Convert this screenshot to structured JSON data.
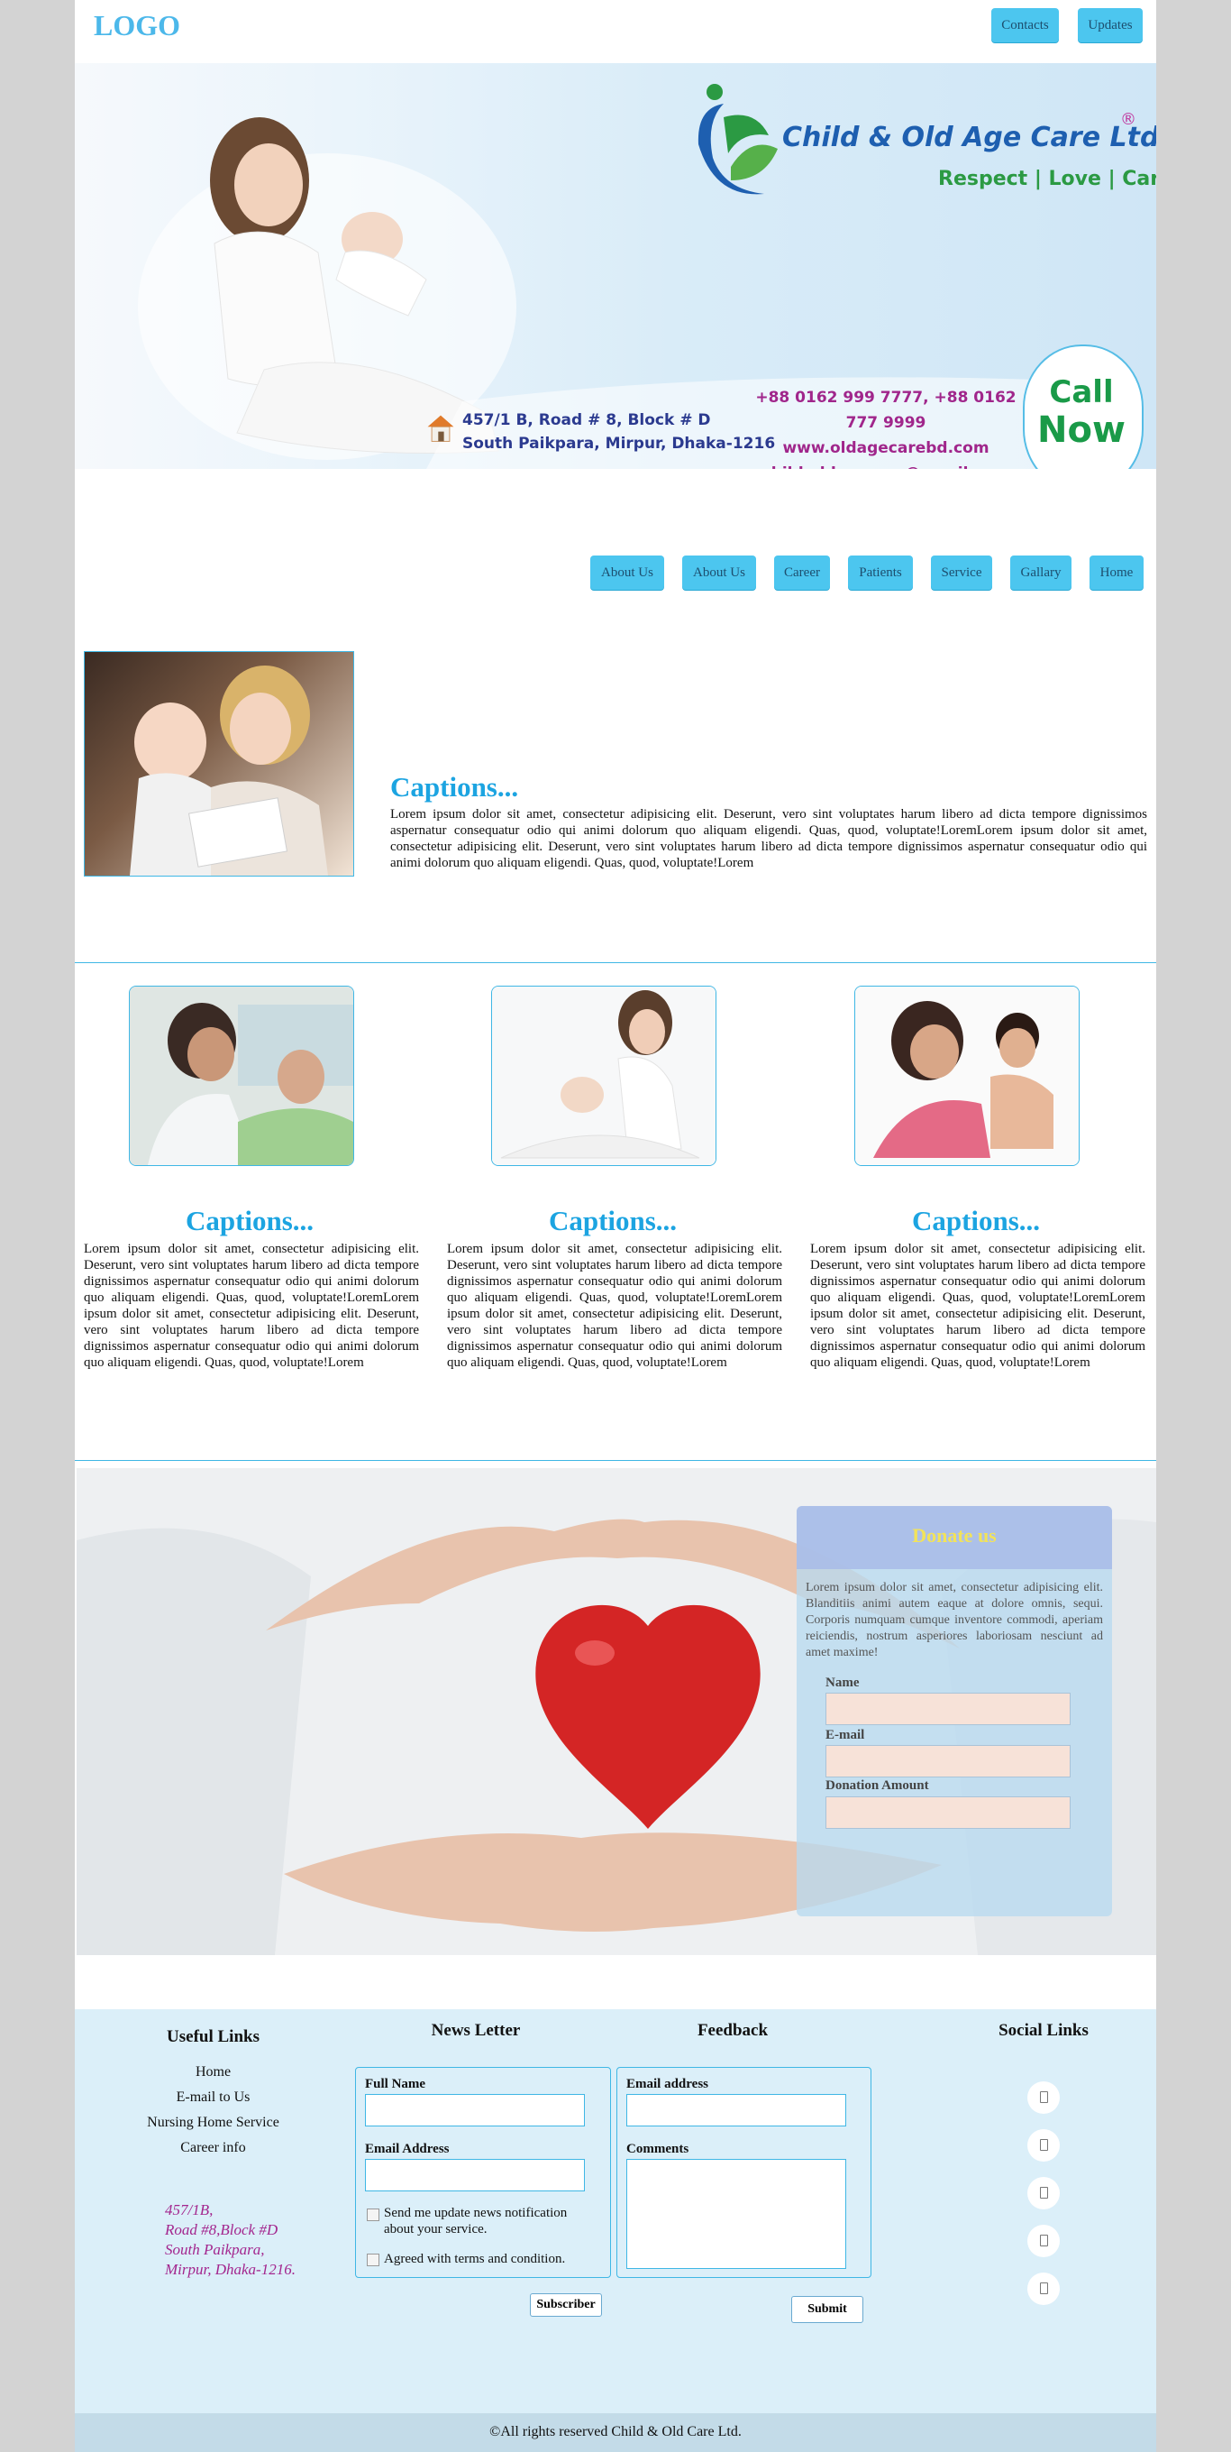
{
  "header": {
    "logo": "LOGO",
    "buttons": [
      "Contacts",
      "Updates"
    ]
  },
  "banner": {
    "brand_name": "Child & Old Age Care Ltd.",
    "brand_reg": "®",
    "tagline": "Respect | Love | Care",
    "address_line1": "457/1 B, Road # 8, Block # D",
    "address_line2": "South Paikpara, Mirpur, Dhaka-1216",
    "phones": "+88 0162 999 7777, +88 0162 777 9999",
    "website": "www.oldagecarebd.com",
    "email": "child.oldagecare@gmail.com",
    "call_line1": "Call",
    "call_line2": "Now"
  },
  "nav": [
    "About Us",
    "About Us",
    "Career",
    "Patients",
    "Service",
    "Gallary",
    "Home"
  ],
  "feature": {
    "caption": "Captions...",
    "text": "Lorem ipsum dolor sit amet, consectetur adipisicing elit. Deserunt, vero sint voluptates harum libero ad dicta tempore dignissimos aspernatur consequatur odio qui animi dolorum quo aliquam eligendi. Quas, quod, voluptate!LoremLorem ipsum dolor sit amet, consectetur adipisicing elit. Deserunt, vero sint voluptates harum libero ad dicta tempore dignissimos aspernatur consequatur odio qui animi dolorum quo aliquam eligendi. Quas, quod, voluptate!Lorem"
  },
  "columns": [
    {
      "caption": "Captions...",
      "text": "Lorem ipsum dolor sit amet, consectetur adipisicing elit. Deserunt, vero sint voluptates harum libero ad dicta tempore dignissimos aspernatur consequatur odio qui animi dolorum quo aliquam eligendi. Quas, quod, voluptate!LoremLorem ipsum dolor sit amet, consectetur adipisicing elit. Deserunt, vero sint voluptates harum libero ad dicta tempore dignissimos aspernatur consequatur odio qui animi dolorum quo aliquam eligendi. Quas, quod, voluptate!Lorem"
    },
    {
      "caption": "Captions...",
      "text": "Lorem ipsum dolor sit amet, consectetur adipisicing elit. Deserunt, vero sint voluptates harum libero ad dicta tempore dignissimos aspernatur consequatur odio qui animi dolorum quo aliquam eligendi. Quas, quod, voluptate!LoremLorem ipsum dolor sit amet, consectetur adipisicing elit. Deserunt, vero sint voluptates harum libero ad dicta tempore dignissimos aspernatur consequatur odio qui animi dolorum quo aliquam eligendi. Quas, quod, voluptate!Lorem"
    },
    {
      "caption": "Captions...",
      "text": "Lorem ipsum dolor sit amet, consectetur adipisicing elit. Deserunt, vero sint voluptates harum libero ad dicta tempore dignissimos aspernatur consequatur odio qui animi dolorum quo aliquam eligendi. Quas, quod, voluptate!LoremLorem ipsum dolor sit amet, consectetur adipisicing elit. Deserunt, vero sint voluptates harum libero ad dicta tempore dignissimos aspernatur consequatur odio qui animi dolorum quo aliquam eligendi. Quas, quod, voluptate!Lorem"
    }
  ],
  "donate": {
    "title": "Donate us",
    "text": "Lorem ipsum dolor sit amet, consectetur adipisicing elit. Blanditiis animi autem eaque at dolore omnis, sequi. Corporis numquam cumque inventore commodi, aperiam reiciendis, nostrum asperiores laboriosam nesciunt ad amet maxime!",
    "name_label": "Name",
    "email_label": "E-mail",
    "amount_label": "Donation Amount"
  },
  "footer": {
    "useful_links_title": "Useful Links",
    "useful_links": [
      "Home",
      "E-mail to Us",
      "Nursing Home Service",
      "Career info"
    ],
    "address": [
      "457/1B,",
      "Road #8,Block #D",
      "South Paikpara,",
      "Mirpur, Dhaka-1216."
    ],
    "newsletter_title": "News Letter",
    "full_name_label": "Full Name",
    "email_address_label": "Email Address",
    "notify_text": "Send me update news notification about your service.",
    "terms_text": "Agreed with terms and condition.",
    "subscribe_label": "Subscriber",
    "feedback_title": "Feedback",
    "feedback_email_label": "Email address",
    "comments_label": "Comments",
    "submit_label": "Submit",
    "social_title": "Social Links",
    "copyright": "©All rights reserved Child & Old Care Ltd."
  },
  "colors": {
    "accent": "#4cc6ef",
    "caption": "#1ca4e1",
    "footer_bg": "#dbeff9",
    "address": "#a3268e"
  }
}
